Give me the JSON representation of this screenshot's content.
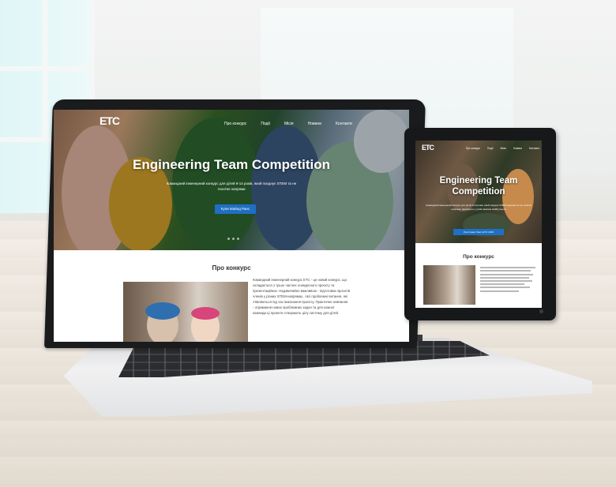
{
  "laptop_site": {
    "logo": "ETC",
    "nav": [
      "Про конкурс",
      "Події",
      "Місія",
      "Новини",
      "Контакти"
    ],
    "hero": {
      "title": "Engineering Team Competition",
      "subtitle": "Командний інженерний конкурс для дітей 9-14 років, який поєднує STEM та не технічні напрями",
      "button": "Купи Майнд Ранс"
    },
    "about": {
      "title": "Про конкурс",
      "text": [
        "Командний інженерний конкурс ETC - це новий конкурс, що",
        "складається з трьох частин: конкурсного проєкту та",
        "презентаційних. Надзвичайно важливою - підготовка проєктів",
        "членів у різних STEM-напрямах, і всі проблемні питання, які",
        "з'являються під час виконання проєкту. Практичне навчання",
        "- отримання нових проблемних задач та для кожної",
        "команди ці проекти створюють цілу систему для дітей."
      ]
    }
  },
  "tablet_site": {
    "logo": "ETC",
    "nav": [
      "Про конкурс",
      "Події",
      "Місія",
      "Новини",
      "Контакти"
    ],
    "hero": {
      "title_line1": "Engineering Team",
      "title_line2": "Competition",
      "subtitle": "Командний інженерний конкурс для дітей 9-14 років, який поєднує STEM напрями та не технічні напрями, формуючи у дітей навички майбутнього",
      "button": "Реєстрація Team ETC 2019"
    },
    "about": {
      "title": "Про конкурс"
    }
  },
  "colors": {
    "accent_button": "#1f6fc4",
    "laptop_frame": "#1a1b1d",
    "tablet_frame": "#17181a"
  }
}
